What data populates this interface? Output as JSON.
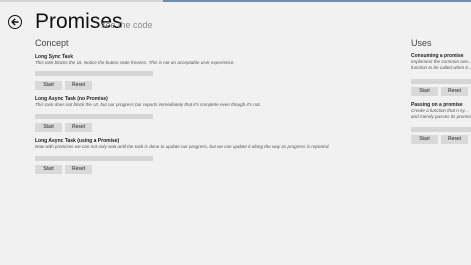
{
  "header": {
    "title": "Promises",
    "see_code": "see the code",
    "back_icon": "back-arrow-icon"
  },
  "concept": {
    "heading": "Concept",
    "tasks": [
      {
        "title": "Long Sync Task",
        "description": "This task blocks the UI. Notice the button state freezes. This is not an acceptable user experience.",
        "progress": 0,
        "start_label": "Start",
        "reset_label": "Reset"
      },
      {
        "title": "Long Async Task (no Promise)",
        "description": "This task does not block the UI, but our progress bar reports immediately that it's complete even though it's not.",
        "progress": 0,
        "start_label": "Start",
        "reset_label": "Reset"
      },
      {
        "title": "Long Async Task (using a Promise)",
        "description": "Now with promises we can not only wait until the task is done to update our progress, but we can update it along the way as progress is reported.",
        "progress": 0,
        "start_label": "Start",
        "reset_label": "Reset"
      }
    ]
  },
  "uses": {
    "heading": "Uses",
    "items": [
      {
        "title": "Consuming a promise",
        "description_lines": [
          "Implement the common one...",
          "function to be called when it..."
        ],
        "progress": 0,
        "start_label": "Start",
        "reset_label": "Reset"
      },
      {
        "title": "Passing on a promise",
        "description_lines": [
          "Create a function that n sy...",
          "and merely passes its promise..."
        ],
        "progress": 0,
        "start_label": "Start",
        "reset_label": "Reset"
      }
    ]
  },
  "colors": {
    "accent": "#6f8fb2",
    "background": "#f1f1f1",
    "button": "#d9d9d9",
    "progress_track": "#d6d6d6"
  }
}
